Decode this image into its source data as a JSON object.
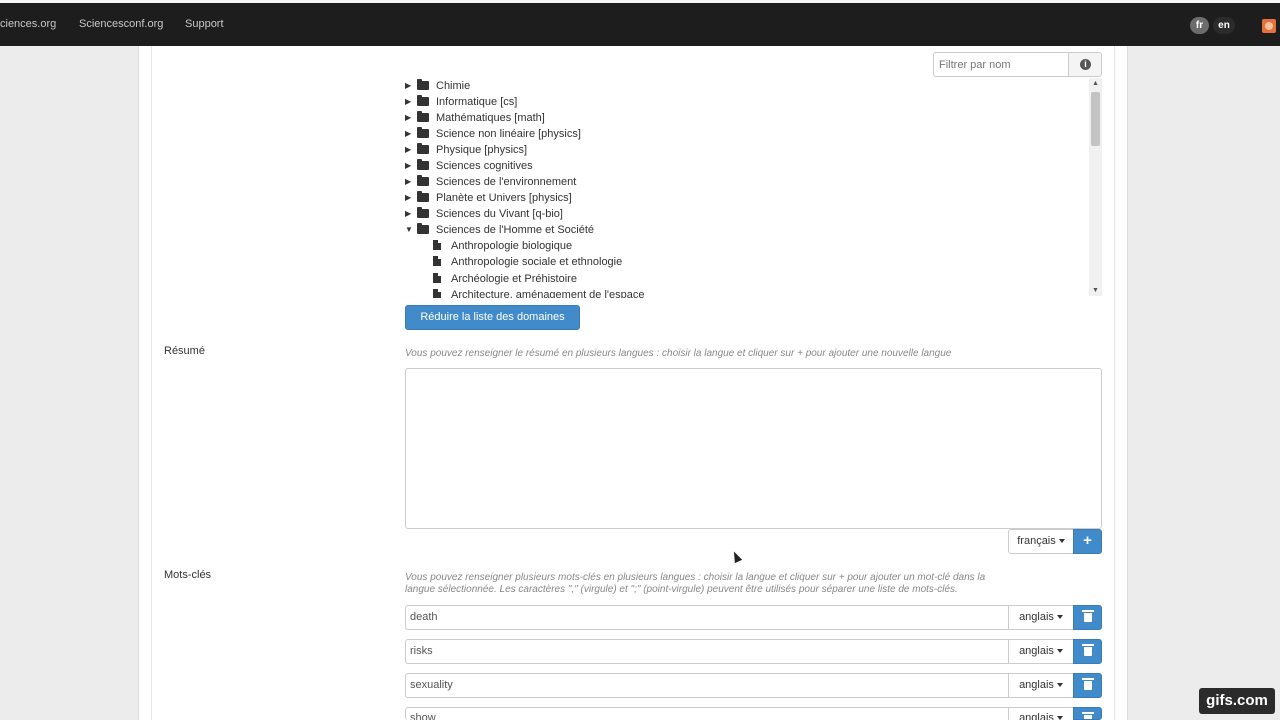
{
  "topbar": {
    "links": [
      "ciences.org",
      "Sciencesconf.org",
      "Support"
    ],
    "lang_fr": "fr",
    "lang_en": "en"
  },
  "filter": {
    "placeholder": "Filtrer par nom",
    "info_icon": "info-circle-icon"
  },
  "tree": {
    "items": [
      {
        "label": "Chimie",
        "expanded": false
      },
      {
        "label": "Informatique [cs]",
        "expanded": false
      },
      {
        "label": "Mathématiques [math]",
        "expanded": false
      },
      {
        "label": "Science non linéaire [physics]",
        "expanded": false
      },
      {
        "label": "Physique [physics]",
        "expanded": false
      },
      {
        "label": "Sciences cognitives",
        "expanded": false
      },
      {
        "label": "Sciences de l'environnement",
        "expanded": false
      },
      {
        "label": "Planète et Univers [physics]",
        "expanded": false
      },
      {
        "label": "Sciences du Vivant [q-bio]",
        "expanded": false
      },
      {
        "label": "Sciences de l'Homme et Société",
        "expanded": true
      }
    ],
    "children": [
      "Anthropologie biologique",
      "Anthropologie sociale et ethnologie",
      "Archéologie et Préhistoire",
      "Architecture, aménagement de l'espace"
    ]
  },
  "reduce_button": "Réduire la liste des domaines",
  "resume": {
    "label": "Résumé",
    "help": "Vous pouvez renseigner le résumé en plusieurs langues : choisir la langue et cliquer sur + pour ajouter une nouvelle langue",
    "language": "français",
    "add_label": "+"
  },
  "keywords": {
    "label": "Mots-clés",
    "help_line1": "Vous pouvez renseigner plusieurs mots-clés en plusieurs langues : choisir la langue et cliquer sur + pour ajouter un mot-clé dans la",
    "help_line2": "langue sélectionnée. Les caractères \",\" (virgule) et \";\" (point-virgule) peuvent être utilisés pour séparer une liste de mots-clés.",
    "rows": [
      {
        "value": "death",
        "language": "anglais"
      },
      {
        "value": "risks",
        "language": "anglais"
      },
      {
        "value": "sexuality",
        "language": "anglais"
      },
      {
        "value": "show",
        "language": "anglais"
      }
    ]
  },
  "watermark": "gifs.com",
  "colors": {
    "primary": "#428bca",
    "topbar": "#1d1d1d"
  }
}
